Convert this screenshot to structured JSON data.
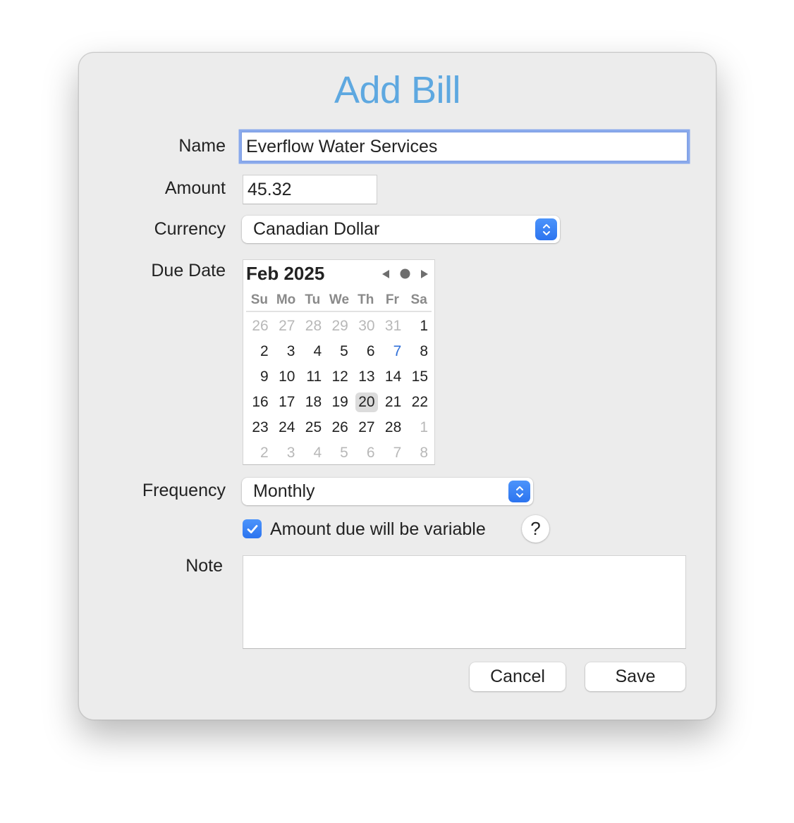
{
  "dialog": {
    "title": "Add Bill"
  },
  "form": {
    "name": {
      "label": "Name",
      "value": "Everflow Water Services"
    },
    "amount": {
      "label": "Amount",
      "value": "45.32"
    },
    "currency": {
      "label": "Currency",
      "selected": "Canadian Dollar"
    },
    "due_date": {
      "label": "Due Date"
    },
    "frequency": {
      "label": "Frequency",
      "selected": "Monthly"
    },
    "variable": {
      "label": "Amount due will be variable",
      "checked": true
    },
    "help": {
      "label": "?"
    },
    "note": {
      "label": "Note",
      "value": ""
    }
  },
  "calendar": {
    "month_label": "Feb 2025",
    "weekdays": [
      "Su",
      "Mo",
      "Tu",
      "We",
      "Th",
      "Fr",
      "Sa"
    ],
    "days": [
      {
        "d": "26",
        "t": "other"
      },
      {
        "d": "27",
        "t": "other"
      },
      {
        "d": "28",
        "t": "other"
      },
      {
        "d": "29",
        "t": "other"
      },
      {
        "d": "30",
        "t": "other"
      },
      {
        "d": "31",
        "t": "other"
      },
      {
        "d": "1",
        "t": "cur"
      },
      {
        "d": "2",
        "t": "cur"
      },
      {
        "d": "3",
        "t": "cur"
      },
      {
        "d": "4",
        "t": "cur"
      },
      {
        "d": "5",
        "t": "cur"
      },
      {
        "d": "6",
        "t": "cur"
      },
      {
        "d": "7",
        "t": "today"
      },
      {
        "d": "8",
        "t": "cur"
      },
      {
        "d": "9",
        "t": "cur"
      },
      {
        "d": "10",
        "t": "cur"
      },
      {
        "d": "11",
        "t": "cur"
      },
      {
        "d": "12",
        "t": "cur"
      },
      {
        "d": "13",
        "t": "cur"
      },
      {
        "d": "14",
        "t": "cur"
      },
      {
        "d": "15",
        "t": "cur"
      },
      {
        "d": "16",
        "t": "cur"
      },
      {
        "d": "17",
        "t": "cur"
      },
      {
        "d": "18",
        "t": "cur"
      },
      {
        "d": "19",
        "t": "cur"
      },
      {
        "d": "20",
        "t": "sel"
      },
      {
        "d": "21",
        "t": "cur"
      },
      {
        "d": "22",
        "t": "cur"
      },
      {
        "d": "23",
        "t": "cur"
      },
      {
        "d": "24",
        "t": "cur"
      },
      {
        "d": "25",
        "t": "cur"
      },
      {
        "d": "26",
        "t": "cur"
      },
      {
        "d": "27",
        "t": "cur"
      },
      {
        "d": "28",
        "t": "cur"
      },
      {
        "d": "1",
        "t": "other"
      },
      {
        "d": "2",
        "t": "other"
      },
      {
        "d": "3",
        "t": "other"
      },
      {
        "d": "4",
        "t": "other"
      },
      {
        "d": "5",
        "t": "other"
      },
      {
        "d": "6",
        "t": "other"
      },
      {
        "d": "7",
        "t": "other"
      },
      {
        "d": "8",
        "t": "other"
      }
    ],
    "selected_date": "20",
    "today": "7",
    "icons": {
      "prev": "chevron-left-icon",
      "today": "today-dot-icon",
      "next": "chevron-right-icon"
    }
  },
  "buttons": {
    "cancel": "Cancel",
    "save": "Save"
  },
  "colors": {
    "accent": "#3b82f6",
    "title": "#5ea8e0",
    "focus_ring": "#89a9ec",
    "today": "#2f6fd8"
  }
}
